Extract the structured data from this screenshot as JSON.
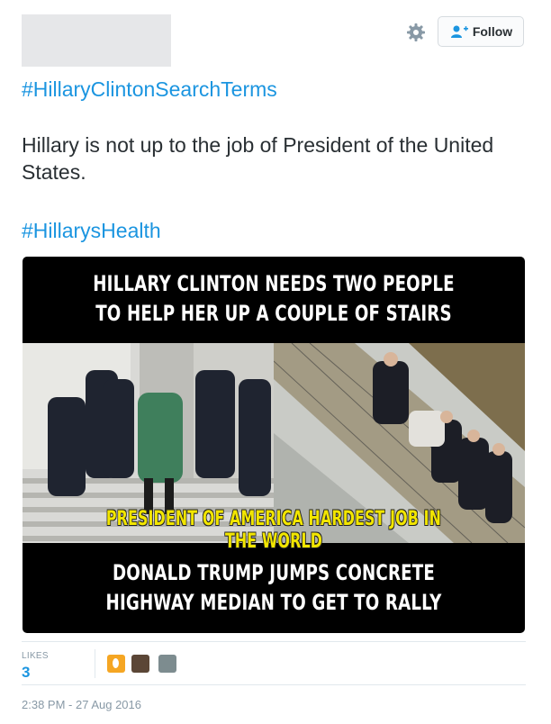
{
  "header": {
    "follow_label": "Follow",
    "gear_icon": "gear-icon",
    "follow_icon": "add-user-icon"
  },
  "tweet": {
    "hashtag_top": "#HillaryClintonSearchTerms",
    "text": "Hillary is not up to the job of President of the United States.",
    "hashtag_bottom": "#HillarysHealth"
  },
  "media": {
    "title_top": "HILLARY CLINTON NEEDS TWO PEOPLE TO HELP HER UP A COUPLE OF STAIRS",
    "caption_middle": "PRESIDENT OF AMERICA HARDEST JOB IN THE WORLD",
    "title_bottom": "DONALD TRUMP JUMPS CONCRETE HIGHWAY MEDIAN TO GET TO RALLY",
    "caption_color": "#f2e600"
  },
  "stats": {
    "likes_label": "LIKES",
    "likes_count": "3"
  },
  "timestamp": "2:38 PM - 27 Aug 2016",
  "colors": {
    "link": "#1b95e0",
    "text": "#292f33",
    "muted": "#8899a6"
  }
}
